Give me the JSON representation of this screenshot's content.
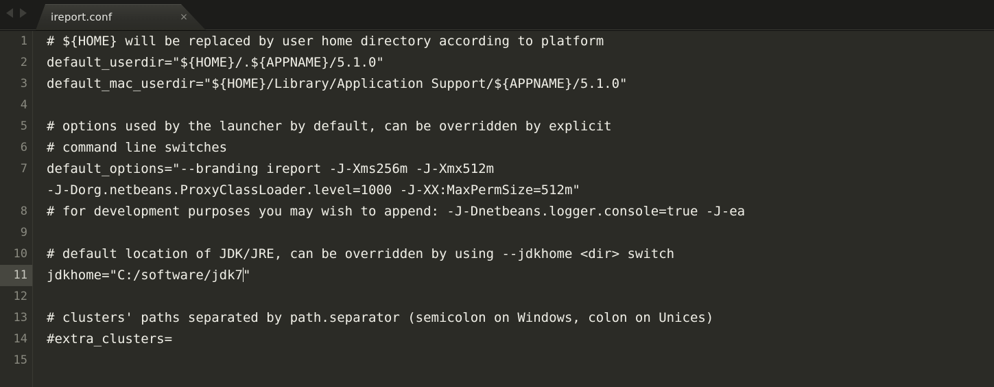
{
  "window": {
    "title": "ireport.conf",
    "background_color": "#2b2b26",
    "text_color": "#f0efe7",
    "gutter_text_color": "#8a8a80",
    "active_line_color": "#474740",
    "tabbar_color": "#1c1c1a"
  },
  "tabbar": {
    "nav_prev_label": "◀",
    "nav_next_label": "▶",
    "tabs": [
      {
        "label": "ireport.conf",
        "close_label": "×",
        "active": true
      }
    ]
  },
  "editor": {
    "active_line": 11,
    "caret": {
      "line": 11,
      "column": 23
    },
    "lines": [
      {
        "number": "1",
        "text": "# ${HOME} will be replaced by user home directory according to platform",
        "continuation": null
      },
      {
        "number": "2",
        "text": "default_userdir=\"${HOME}/.${APPNAME}/5.1.0\"",
        "continuation": null
      },
      {
        "number": "3",
        "text": "default_mac_userdir=\"${HOME}/Library/Application Support/${APPNAME}/5.1.0\"",
        "continuation": null
      },
      {
        "number": "4",
        "text": "",
        "continuation": null
      },
      {
        "number": "5",
        "text": "# options used by the launcher by default, can be overridden by explicit",
        "continuation": null
      },
      {
        "number": "6",
        "text": "# command line switches",
        "continuation": null
      },
      {
        "number": "7",
        "text": "default_options=\"--branding ireport -J-Xms256m -J-Xmx512m",
        "continuation": "-J-Dorg.netbeans.ProxyClassLoader.level=1000 -J-XX:MaxPermSize=512m\""
      },
      {
        "number": "8",
        "text": "# for development purposes you may wish to append: -J-Dnetbeans.logger.console=true -J-ea",
        "continuation": null
      },
      {
        "number": "9",
        "text": "",
        "continuation": null
      },
      {
        "number": "10",
        "text": "# default location of JDK/JRE, can be overridden by using --jdkhome <dir> switch",
        "continuation": null
      },
      {
        "number": "11",
        "text_before_caret": "jdkhome=\"C:/software/jdk7",
        "text_after_caret": "\"",
        "text": "jdkhome=\"C:/software/jdk7\"",
        "continuation": null
      },
      {
        "number": "12",
        "text": "",
        "continuation": null
      },
      {
        "number": "13",
        "text": "# clusters' paths separated by path.separator (semicolon on Windows, colon on Unices)",
        "continuation": null
      },
      {
        "number": "14",
        "text": "#extra_clusters=",
        "continuation": null
      },
      {
        "number": "15",
        "text": "",
        "continuation": null
      }
    ]
  }
}
